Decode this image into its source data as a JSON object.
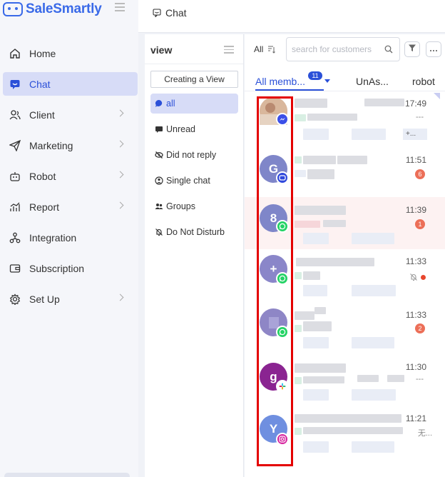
{
  "app": {
    "name": "SaleSmartly"
  },
  "nav": [
    {
      "label": "Home",
      "icon": "home-icon",
      "chevron": false
    },
    {
      "label": "Chat",
      "icon": "chat-icon",
      "chevron": false,
      "active": true
    },
    {
      "label": "Client",
      "icon": "users-icon",
      "chevron": true
    },
    {
      "label": "Marketing",
      "icon": "send-icon",
      "chevron": true
    },
    {
      "label": "Robot",
      "icon": "robot-icon",
      "chevron": true
    },
    {
      "label": "Report",
      "icon": "chart-icon",
      "chevron": true
    },
    {
      "label": "Integration",
      "icon": "integration-icon",
      "chevron": false
    },
    {
      "label": "Subscription",
      "icon": "wallet-icon",
      "chevron": false
    },
    {
      "label": "Set Up",
      "icon": "gear-icon",
      "chevron": true
    }
  ],
  "header": {
    "title": "Chat"
  },
  "views": {
    "title": "view",
    "create_label": "Creating a View",
    "items": [
      {
        "label": "all",
        "icon": "chat-bubble-icon",
        "active": true
      },
      {
        "label": "Unread",
        "icon": "message-icon"
      },
      {
        "label": "Did not reply",
        "icon": "eye-off-icon"
      },
      {
        "label": "Single chat",
        "icon": "person-icon"
      },
      {
        "label": "Groups",
        "icon": "group-icon"
      },
      {
        "label": "Do Not Disturb",
        "icon": "bell-off-icon"
      }
    ]
  },
  "list": {
    "filter_label": "All",
    "search_placeholder": "search for customers",
    "tabs": [
      {
        "label": "All memb...",
        "badge": "11",
        "active": true
      },
      {
        "label": "UnAs..."
      },
      {
        "label": "robot"
      }
    ],
    "conversations": [
      {
        "avatar_letter": "",
        "avatar_kind": "photo",
        "channel": "messenger",
        "time": "17:49",
        "tail": "---",
        "chip": "+..."
      },
      {
        "avatar_letter": "G",
        "avatar_color": "#7f86c9",
        "channel": "chat",
        "time": "11:51",
        "badge": "6"
      },
      {
        "avatar_letter": "8",
        "avatar_color": "#7f86c9",
        "channel": "whatsapp",
        "time": "11:39",
        "badge": "1",
        "highlight": true
      },
      {
        "avatar_letter": "+",
        "avatar_color": "#8a86c9",
        "channel": "whatsapp",
        "time": "11:33",
        "muted": true
      },
      {
        "avatar_letter": "",
        "avatar_color": "#8e86c6",
        "channel": "whatsapp",
        "time": "11:33",
        "badge": "2"
      },
      {
        "avatar_letter": "g",
        "avatar_color": "#8a2491",
        "channel": "slack",
        "time": "11:30",
        "tail": "---"
      },
      {
        "avatar_letter": "Y",
        "avatar_color": "#6f8fe0",
        "channel": "instagram",
        "time": "11:21",
        "tail": "无..."
      }
    ]
  }
}
